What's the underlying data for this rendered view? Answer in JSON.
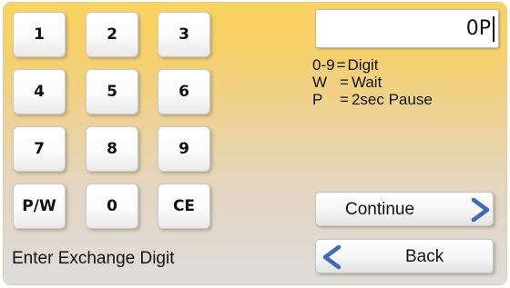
{
  "keypad": {
    "keys": [
      "1",
      "2",
      "3",
      "4",
      "5",
      "6",
      "7",
      "8",
      "9",
      "P/W",
      "0",
      "CE"
    ]
  },
  "display": {
    "value": "0P"
  },
  "legend": {
    "rows": [
      {
        "key": "0-9",
        "sep": "=",
        "text": "Digit"
      },
      {
        "key": "W",
        "sep": "=",
        "text": "Wait"
      },
      {
        "key": "P",
        "sep": "=",
        "text": "2sec Pause"
      }
    ]
  },
  "buttons": {
    "continue_label": "Continue",
    "continue_icon": "chevron-right-icon",
    "back_label": "Back",
    "back_icon": "chevron-left-icon",
    "arrow_color": "#3d6db5"
  },
  "status": {
    "text": "Enter Exchange Digit"
  }
}
